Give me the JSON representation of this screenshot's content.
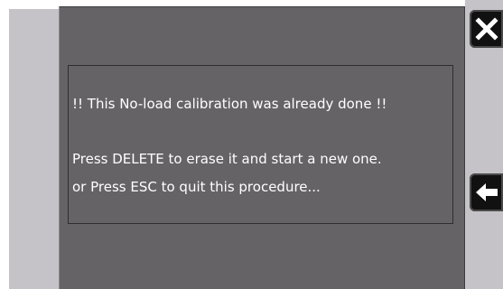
{
  "dialog": {
    "line1": "!! This No-load calibration was already done !!",
    "line2": "Press DELETE to erase it and start a new one.",
    "line3": "or Press ESC to quit this procedure..."
  },
  "buttons": {
    "close_icon": "close-x-icon",
    "back_icon": "arrow-left-icon"
  },
  "colors": {
    "panel": "#656366",
    "side_strip": "#c5c3c8",
    "button": "#111111",
    "text": "#ffffff"
  }
}
